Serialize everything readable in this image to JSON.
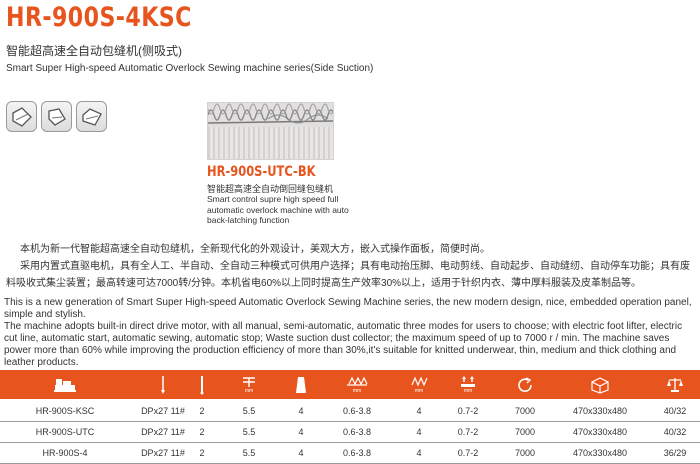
{
  "header": {
    "title": "HR-900S-4KSC",
    "subtitle_cn": "智能超高速全自动包缝机(侧吸式)",
    "subtitle_en": "Smart Super High-speed Automatic  Overlock Sewing machine series(Side Suction)"
  },
  "thumbnails": [
    {
      "icon": "presser-foot-icon"
    },
    {
      "icon": "presser-foot-angled-icon"
    },
    {
      "icon": "presser-foot-wide-icon"
    }
  ],
  "model": {
    "name": "HR-900S-UTC-BK",
    "desc_cn": "智能超高速全自动倒回缝包缝机",
    "desc_en": "Smart control supre high speed full automatic overlock machine with auto back-latching function"
  },
  "description_cn": [
    "本机为新一代智能超高速全自动包缝机，全新现代化的外观设计，美观大方，嵌入式操作面板，简便时尚。",
    "采用内置式直驱电机，具有全人工、半自动、全自动三种模式可供用户选择；具有电动抬压脚、电动剪线、自动起步、自动缝纫、自动停车功能；具有废料吸收式集尘装置；最高转速可达7000转/分钟。本机省电60%以上同时提高生产效率30%以上，适用于针织内衣、薄中厚料服装及皮革制品等。"
  ],
  "description_en": [
    "This is a new generation of Smart Super High-speed Automatic Overlock Sewing Machine series, the new modern design, nice, embedded operation panel, simple and stylish.",
    "The machine adopts built-in direct drive motor, with all manual, semi-automatic, automatic three modes for users to choose; with electric foot lifter, electric cut line, automatic start, automatic sewing, automatic stop; Waste suction dust collector; the maximum speed of up to 7000 r / min. The machine saves power more than 60% while improving the production efficiency of more than 30%,it's suitable for knitted underwear, thin, medium and thick clothing and leather products."
  ],
  "specs": {
    "header_icons": [
      {
        "icon": "machine-icon"
      },
      {
        "icon": "needle-icon"
      },
      {
        "icon": "needle-count-icon"
      },
      {
        "icon": "stitch-length-icon",
        "unit": "mm"
      },
      {
        "icon": "thread-cone-icon"
      },
      {
        "icon": "differential-feed-icon",
        "unit": "mm"
      },
      {
        "icon": "stitch-width-icon",
        "unit": "mm"
      },
      {
        "icon": "presser-foot-lift-icon",
        "unit": "mm"
      },
      {
        "icon": "speed-icon"
      },
      {
        "icon": "package-size-icon"
      },
      {
        "icon": "weight-icon"
      }
    ],
    "rows": [
      [
        "HR-900S-KSC",
        "DPx27 11#",
        "2",
        "5.5",
        "4",
        "0.6-3.8",
        "4",
        "0.7-2",
        "7000",
        "470x330x480",
        "40/32"
      ],
      [
        "HR-900S-UTC",
        "DPx27 11#",
        "2",
        "5.5",
        "4",
        "0.6-3.8",
        "4",
        "0.7-2",
        "7000",
        "470x330x480",
        "40/32"
      ],
      [
        "HR-900S-4",
        "DPx27 11#",
        "2",
        "5.5",
        "4",
        "0.6-3.8",
        "4",
        "0.7-2",
        "7000",
        "470x330x480",
        "36/29"
      ]
    ]
  },
  "colors": {
    "accent": "#e8541e",
    "text": "#333333",
    "rule": "#9a9a9a"
  }
}
